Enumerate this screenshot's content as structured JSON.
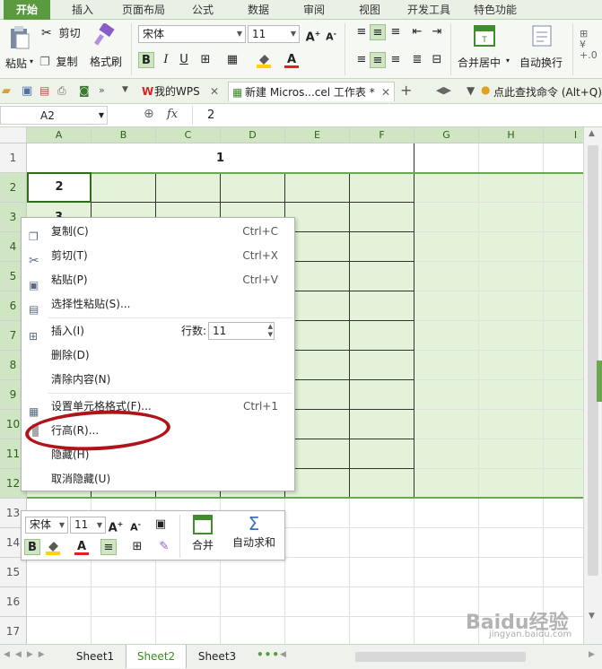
{
  "ribbon_tabs": [
    "开始",
    "插入",
    "页面布局",
    "公式",
    "数据",
    "审阅",
    "视图",
    "开发工具",
    "特色功能"
  ],
  "clipboard": {
    "paste": "粘贴",
    "cut": "剪切",
    "copy": "复制",
    "format_painter": "格式刷"
  },
  "font": {
    "name": "宋体",
    "size": "11"
  },
  "alignment": {
    "merge_center": "合并居中",
    "wrap_text": "自动换行"
  },
  "quick": {
    "tab_wps": "我的WPS",
    "tab_doc": "新建 Micros...cel 工作表 *",
    "search_hint": "点此查找命令 (Alt+Q)"
  },
  "formula_bar": {
    "name_box": "A2",
    "fx": "fx",
    "value": "2"
  },
  "columns": [
    "A",
    "B",
    "C",
    "D",
    "E",
    "F",
    "G",
    "H",
    "I"
  ],
  "rows": [
    "1",
    "2",
    "3",
    "4",
    "5",
    "6",
    "7",
    "8",
    "9",
    "10",
    "11",
    "12",
    "13",
    "14",
    "15",
    "16",
    "17"
  ],
  "cells": {
    "A1_merged": "1",
    "A2": "2",
    "A3": "3"
  },
  "context_menu": {
    "copy": {
      "label": "复制(C)",
      "shortcut": "Ctrl+C"
    },
    "cut": {
      "label": "剪切(T)",
      "shortcut": "Ctrl+X"
    },
    "paste": {
      "label": "粘贴(P)",
      "shortcut": "Ctrl+V"
    },
    "paste_special": {
      "label": "选择性粘贴(S)..."
    },
    "insert": {
      "label": "插入(I)",
      "rows_label": "行数:",
      "rows_value": "11"
    },
    "delete": {
      "label": "删除(D)"
    },
    "clear": {
      "label": "清除内容(N)"
    },
    "format_cells": {
      "label": "设置单元格格式(F)...",
      "shortcut": "Ctrl+1"
    },
    "row_height": {
      "label": "行高(R)..."
    },
    "hide": {
      "label": "隐藏(H)"
    },
    "unhide": {
      "label": "取消隐藏(U)"
    }
  },
  "mini_toolbar": {
    "font": "宋体",
    "size": "11",
    "merge": "合并",
    "autosum": "自动求和"
  },
  "sheets": [
    "Sheet1",
    "Sheet2",
    "Sheet3"
  ],
  "active_sheet": "Sheet2",
  "watermark": {
    "brand": "Baidu经验",
    "url": "jingyan.baidu.com"
  },
  "colors": {
    "accent": "#5b9a3e",
    "selection": "#e3f2d8",
    "highlight_border": "#6aa84f",
    "annotation": "#b01418"
  }
}
